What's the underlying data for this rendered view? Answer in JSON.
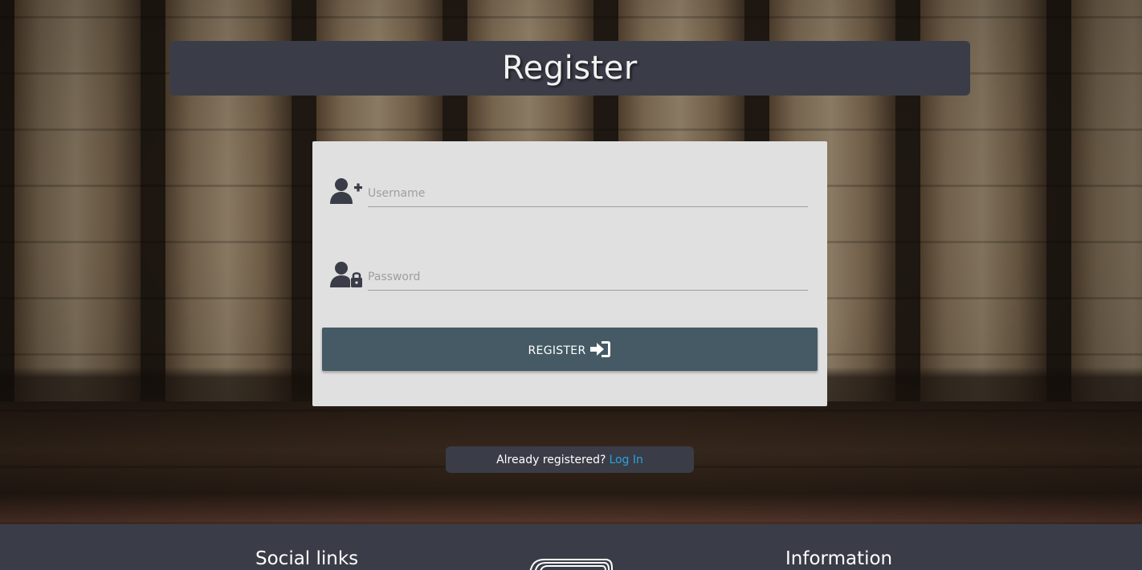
{
  "page": {
    "title": "Register"
  },
  "form": {
    "username_placeholder": "Username",
    "password_placeholder": "Password",
    "username_icon": "user-plus-icon",
    "password_icon": "user-lock-icon",
    "register_label": "REGISTER",
    "register_icon": "sign-in-icon"
  },
  "login_prompt": {
    "question": "Already registered?",
    "link_label": "Log In",
    "link_color": "#2f9fe0"
  },
  "footer": {
    "social_heading": "Social links",
    "info_heading": "Information",
    "logo_icon": "stacked-books-logo"
  },
  "colors": {
    "bar_background": "#3a3d47",
    "card_background": "#e0e0e0",
    "button_background": "#455a64"
  }
}
